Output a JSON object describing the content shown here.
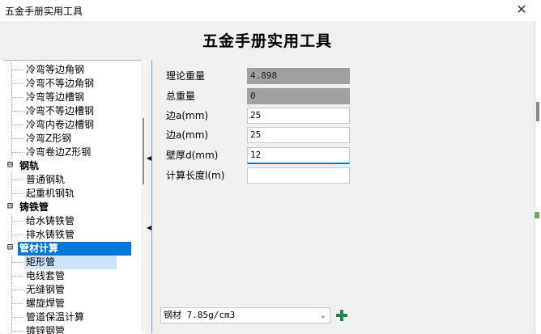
{
  "window": {
    "title": "五金手册实用工具",
    "close_glyph": "✕"
  },
  "header": {
    "banner": "五金手册实用工具"
  },
  "tree": {
    "items": [
      {
        "label": "冷弯等边角钢",
        "kind": "leaf",
        "state": ""
      },
      {
        "label": "冷弯不等边角钢",
        "kind": "leaf",
        "state": ""
      },
      {
        "label": "冷弯等边槽钢",
        "kind": "leaf",
        "state": ""
      },
      {
        "label": "冷弯不等边槽钢",
        "kind": "leaf",
        "state": ""
      },
      {
        "label": "冷弯内卷边槽钢",
        "kind": "leaf",
        "state": ""
      },
      {
        "label": "冷弯Z形钢",
        "kind": "leaf",
        "state": ""
      },
      {
        "label": "冷弯卷边Z形钢",
        "kind": "leaf",
        "state": ""
      },
      {
        "label": "钢轨",
        "kind": "cat",
        "state": ""
      },
      {
        "label": "普通钢轨",
        "kind": "leaf",
        "state": ""
      },
      {
        "label": "起重机钢轨",
        "kind": "leaf",
        "state": ""
      },
      {
        "label": "铸铁管",
        "kind": "cat",
        "state": ""
      },
      {
        "label": "给水铸铁管",
        "kind": "leaf",
        "state": ""
      },
      {
        "label": "排水铸铁管",
        "kind": "leaf",
        "state": ""
      },
      {
        "label": "管材计算",
        "kind": "cat",
        "state": "selected"
      },
      {
        "label": "矩形管",
        "kind": "leaf",
        "state": "active"
      },
      {
        "label": "电线套管",
        "kind": "leaf",
        "state": ""
      },
      {
        "label": "无缝钢管",
        "kind": "leaf",
        "state": ""
      },
      {
        "label": "螺旋焊管",
        "kind": "leaf",
        "state": ""
      },
      {
        "label": "管道保温计算",
        "kind": "leaf",
        "state": ""
      },
      {
        "label": "镀锌钢管",
        "kind": "leaf",
        "state": ""
      }
    ],
    "collapse_glyph": "⊟"
  },
  "form": {
    "fields": [
      {
        "label": "理论重量",
        "value": "4.898",
        "readonly": true,
        "focused": false
      },
      {
        "label": "总重量",
        "value": "0",
        "readonly": true,
        "focused": false
      },
      {
        "label": "边a(mm)",
        "value": "25",
        "readonly": false,
        "focused": false
      },
      {
        "label": "边a(mm)",
        "value": "25",
        "readonly": false,
        "focused": false
      },
      {
        "label": "壁厚d(mm)",
        "value": "12",
        "readonly": false,
        "focused": true
      },
      {
        "label": "计算长度l(m)",
        "value": "",
        "readonly": false,
        "focused": false
      }
    ]
  },
  "material": {
    "selected": "钢材 7.85g/cm3",
    "chevron": "⌄"
  },
  "splitter": {
    "arrow_glyph": "◀"
  },
  "colors": {
    "selection": "#0078d7",
    "active_leaf": "#cce4f7",
    "add_icon": "#1a8a4a",
    "readonly_field": "#a0a0a0"
  }
}
